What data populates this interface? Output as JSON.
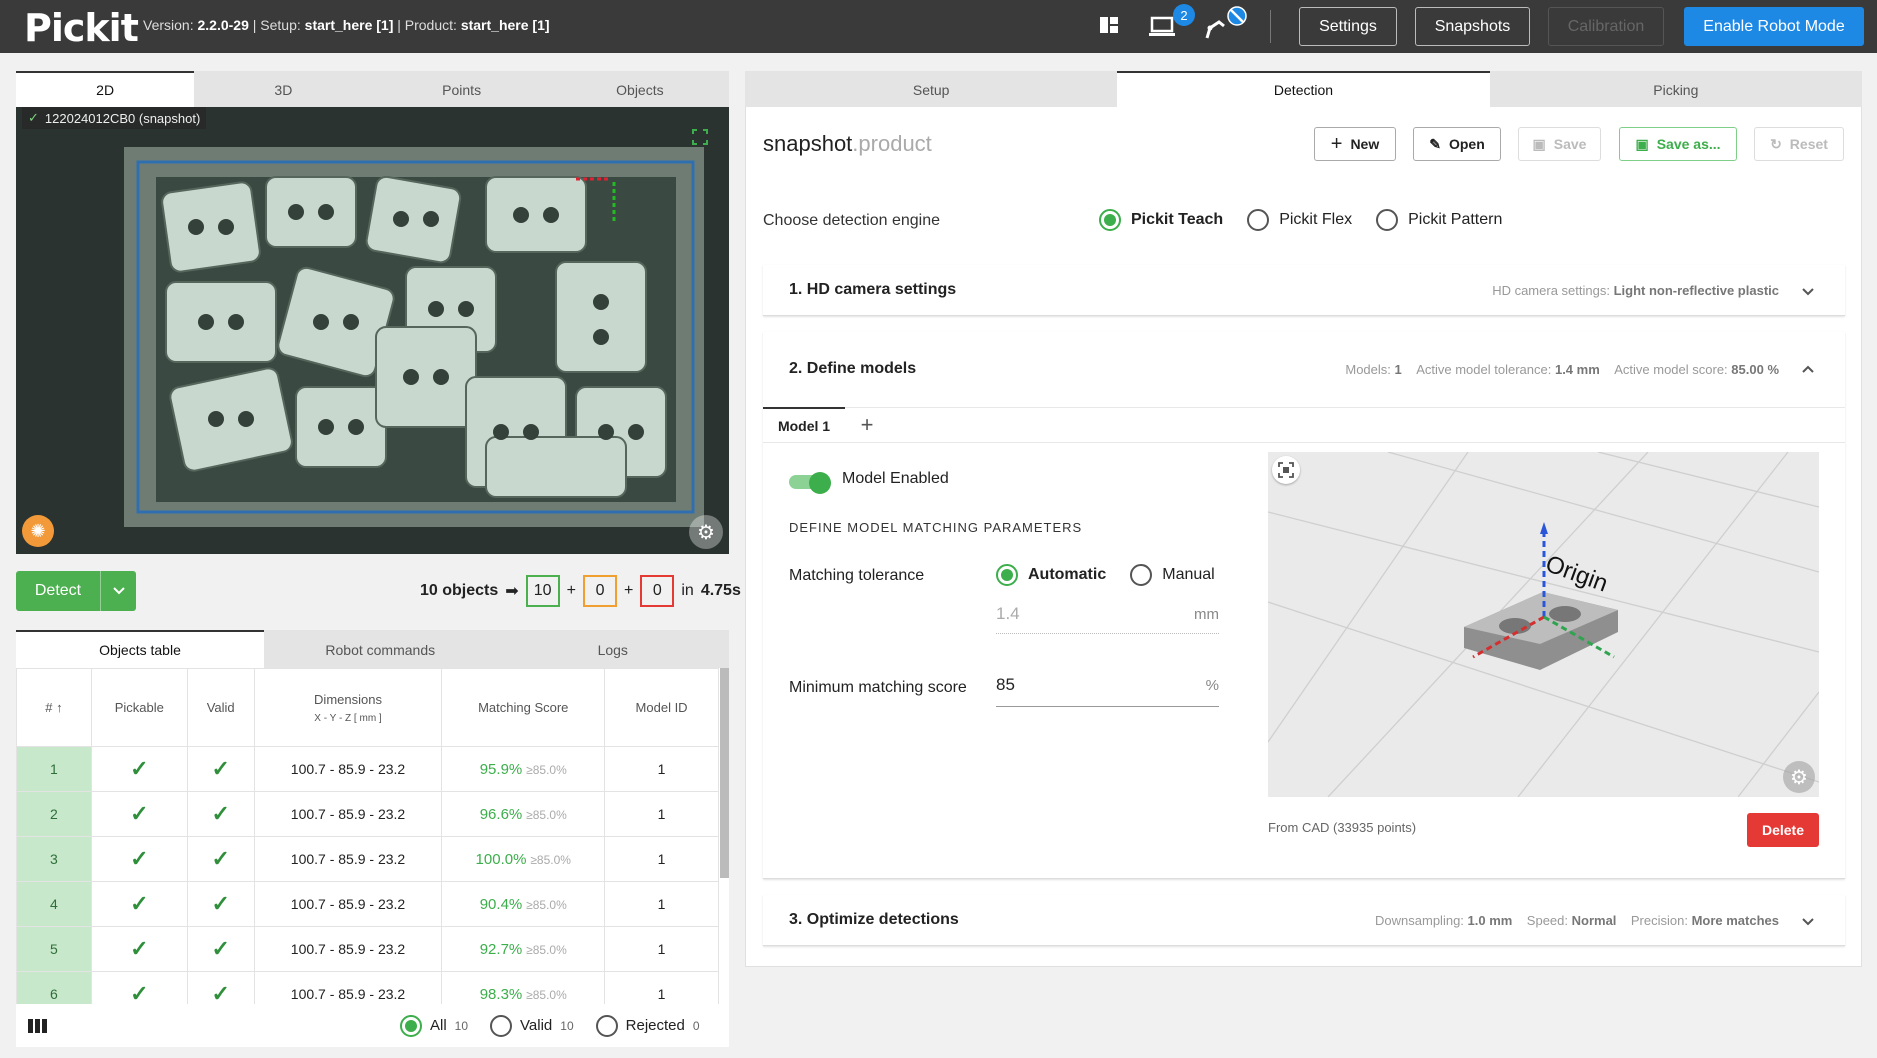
{
  "topbar": {
    "logo": "Pickit",
    "version_label": "Version:",
    "version": "2.2.0-29",
    "setup_label": " | Setup:",
    "setup": "start_here [1]",
    "product_label": " | Product:",
    "product": "start_here [1]",
    "camera_badge": "2",
    "settings": "Settings",
    "snapshots": "Snapshots",
    "calibration": "Calibration",
    "enable_robot": "Enable Robot Mode"
  },
  "view_tabs": [
    "2D",
    "3D",
    "Points",
    "Objects"
  ],
  "camera": {
    "label": "122024012CB0 (snapshot)"
  },
  "detect": {
    "button": "Detect",
    "objects_count": "10 objects",
    "green": "10",
    "orange": "0",
    "red": "0",
    "in_label": "in",
    "time": "4.75s"
  },
  "bottom_tabs": [
    "Objects table",
    "Robot commands",
    "Logs"
  ],
  "objects_table": {
    "headers": {
      "id": "#",
      "pickable": "Pickable",
      "valid": "Valid",
      "dimensions": "Dimensions",
      "dimensions_sub": "X - Y - Z [ mm ]",
      "score": "Matching Score",
      "model": "Model ID"
    },
    "rows": [
      {
        "id": "1",
        "dims": "100.7 - 85.9 - 23.2",
        "score": "95.9%",
        "min": "≥85.0%",
        "model": "1"
      },
      {
        "id": "2",
        "dims": "100.7 - 85.9 - 23.2",
        "score": "96.6%",
        "min": "≥85.0%",
        "model": "1"
      },
      {
        "id": "3",
        "dims": "100.7 - 85.9 - 23.2",
        "score": "100.0%",
        "min": "≥85.0%",
        "model": "1"
      },
      {
        "id": "4",
        "dims": "100.7 - 85.9 - 23.2",
        "score": "90.4%",
        "min": "≥85.0%",
        "model": "1"
      },
      {
        "id": "5",
        "dims": "100.7 - 85.9 - 23.2",
        "score": "92.7%",
        "min": "≥85.0%",
        "model": "1"
      },
      {
        "id": "6",
        "dims": "100.7 - 85.9 - 23.2",
        "score": "98.3%",
        "min": "≥85.0%",
        "model": "1"
      }
    ]
  },
  "filter": {
    "all": "All",
    "all_count": "10",
    "valid": "Valid",
    "valid_count": "10",
    "rejected": "Rejected",
    "rejected_count": "0"
  },
  "right_tabs": [
    "Setup",
    "Detection",
    "Picking"
  ],
  "product": {
    "name": "snapshot",
    "suffix": ".product",
    "new": "New",
    "open": "Open",
    "save": "Save",
    "save_as": "Save as...",
    "reset": "Reset"
  },
  "engine": {
    "label": "Choose detection engine",
    "options": [
      "Pickit Teach",
      "Pickit Flex",
      "Pickit Pattern"
    ]
  },
  "section1": {
    "title": "1. HD camera settings",
    "summary_label": "HD camera settings:",
    "summary_value": "Light non-reflective plastic"
  },
  "section2": {
    "title": "2. Define models",
    "models_label": "Models:",
    "models_value": "1",
    "tol_label": "Active model tolerance:",
    "tol_value": "1.4 mm",
    "score_label": "Active model score:",
    "score_value": "85.00 %",
    "model_tab": "Model 1",
    "add_tab": "+",
    "enabled": "Model Enabled",
    "params_heading": "DEFINE MODEL MATCHING PARAMETERS",
    "tolerance_label": "Matching tolerance",
    "tol_auto": "Automatic",
    "tol_manual": "Manual",
    "tol_input": "1.4",
    "tol_unit": "mm",
    "min_score_label": "Minimum matching score",
    "min_score": "85",
    "min_unit": "%",
    "origin": "Origin",
    "cad_info": "From CAD (33935 points)",
    "delete": "Delete"
  },
  "section3": {
    "title": "3. Optimize detections",
    "ds_label": "Downsampling:",
    "ds_value": "1.0 mm",
    "speed_label": "Speed:",
    "speed_value": "Normal",
    "prec_label": "Precision:",
    "prec_value": "More matches"
  },
  "colors": {
    "accent_green": "#3cae4b",
    "brand_blue": "#1e88e5",
    "danger_red": "#e53935",
    "orange": "#f0a030",
    "topbar": "#3a3a3a"
  }
}
